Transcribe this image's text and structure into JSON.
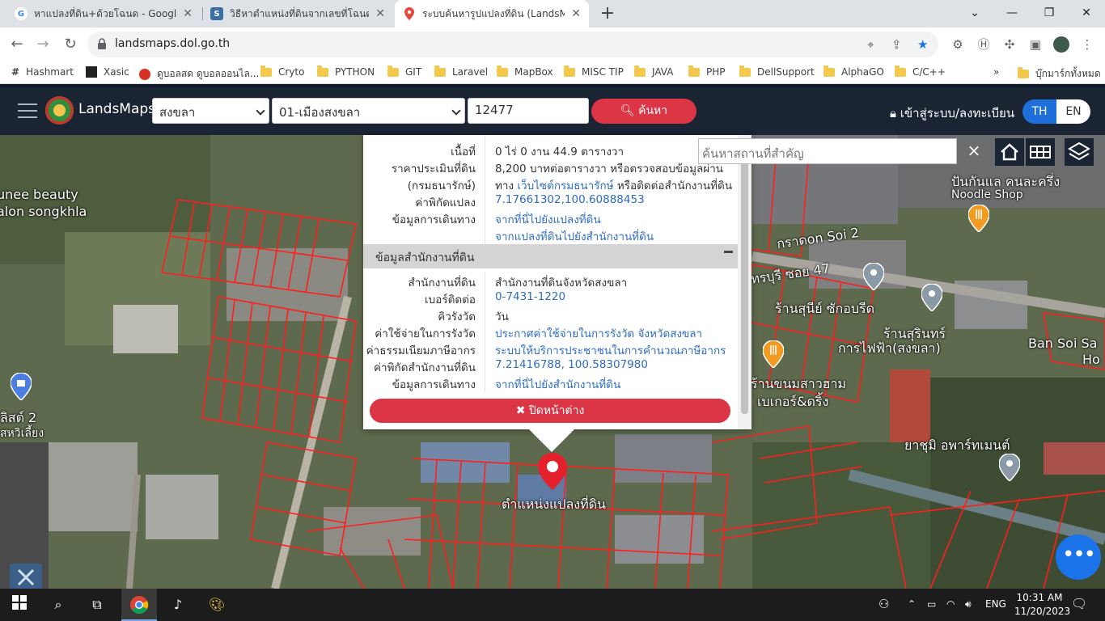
{
  "browser": {
    "tabs": [
      {
        "title": "หาแปลงที่ดิน+ด้วยโฉนด - Google Se",
        "favicon": "google-icon"
      },
      {
        "title": "วิธีหาตำแหน่งที่ดินจากเลขที่โฉนด",
        "favicon": "site-icon"
      },
      {
        "title": "ระบบค้นหารูปแปลงที่ดิน (LandsMaps)",
        "favicon": "map-pin-icon"
      }
    ],
    "new_tab": "+",
    "url": "landsmaps.dol.go.th",
    "bookmarks": [
      "Hashmart",
      "Xasic",
      "ดูบอลสด ดูบอลออนไล...",
      "Cryto",
      "PYTHON",
      "GIT",
      "Laravel",
      "MapBox",
      "MISC TIP",
      "JAVA",
      "PHP",
      "DellSupport",
      "AlphaGO",
      "C/C++"
    ],
    "bookmarks_more": "»",
    "other_bookmarks": "บุ๊กมาร์กทั้งหมด"
  },
  "header": {
    "brand": "LandsMaps",
    "province": "สงขลา",
    "district": "01-เมืองสงขลา",
    "parcel_number": "12477",
    "search_label": "ค้นหา",
    "login_label": "เข้าสู่ระบบ/ลงทะเบียน",
    "lang_th": "TH",
    "lang_en": "EN"
  },
  "popup": {
    "parcel_rows": [
      {
        "label": "เนื้อที่",
        "value": "0 ไร่ 0 งาน 44.9 ตารางวา"
      },
      {
        "label": "ราคาประเมินที่ดิน",
        "value": "8,200 บาทต่อตารางวา หรือตรวจสอบข้อมูลผ่าน"
      },
      {
        "label": "(กรมธนารักษ์)",
        "value_prefix": "ทาง",
        "link": "เว็บไซต์กรมธนารักษ์",
        "value_suffix": "หรือติดต่อสำนักงานที่ดิน"
      },
      {
        "label": "ค่าพิกัดแปลง",
        "value": "7.17661302,100.60888453"
      },
      {
        "label": "ข้อมูลการเดินทาง",
        "value": "จากที่นี่ไปยังแปลงที่ดิน"
      },
      {
        "label": "",
        "value": "จากแปลงที่ดินไปยังสำนักงานที่ดิน"
      }
    ],
    "office_section_title": "ข้อมูลสำนักงานที่ดิน",
    "office_rows": [
      {
        "label": "สำนักงานที่ดิน",
        "value": "สำนักงานที่ดินจังหวัดสงขลา"
      },
      {
        "label": "เบอร์ติดต่อ",
        "value": "0-7431-1220"
      },
      {
        "label": "คิวรังวัด",
        "value": "วัน"
      },
      {
        "label": "ค่าใช้จ่ายในการรังวัด",
        "value": "ประกาศค่าใช้จ่ายในการรังวัด จังหวัดสงขลา"
      },
      {
        "label": "ค่าธรรมเนียมภาษีอากร",
        "value": "ระบบให้บริการประชาชนในการคำนวณภาษีอากร"
      },
      {
        "label": "ค่าพิกัดสำนักงานที่ดิน",
        "value": "7.21416788, 100.58307980"
      },
      {
        "label": "ข้อมูลการเดินทาง",
        "value": "จากที่นี่ไปยังสำนักงานที่ดิน"
      }
    ],
    "close_label": "ปิดหน้าต่าง"
  },
  "map": {
    "place_search_placeholder": "ค้นหาสถานที่สำคัญ",
    "clear_label": "×",
    "labels": {
      "salon_1": "unee beauty",
      "salon_2": "alon songkhla",
      "noodle_1": "ปันกันแล คนละครึ่ง",
      "noodle_2": "Noodle Shop",
      "soi_2": "กราดon Soi 2",
      "soi_47": "ทรบุรี ซอย 47",
      "shop_1": "ร้านสุนีย์ ซักอบรีด",
      "shop_2": "ร้านสุรินทร์",
      "electric": "การไฟฟ้า(สงขลา)",
      "ban_soi_1": "Ban Soi Sa",
      "ban_soi_2": "Ho",
      "dessert_1": "ร้านขนมสาวฮาม",
      "dessert_2": "เบเกอร์&ดริ้ง",
      "apartment": "ยาชุมิ อพาร์ทเมนต์",
      "left_1": "ลิสต์ 2",
      "left_2": "สหวิเลี้ยง",
      "top_right": "ร้าน",
      "parcel_marker": "ตำแหน่งแปลงที่ดิน"
    }
  },
  "taskbar": {
    "lang": "ENG",
    "time": "10:31 AM",
    "date": "11/20/2023"
  },
  "colors": {
    "brand_red": "#dc3545",
    "header_navy": "#1a2433",
    "link_blue": "#2d6cc7",
    "parcel_line": "#ff1e1e",
    "lang_active": "#1e6fd9"
  }
}
